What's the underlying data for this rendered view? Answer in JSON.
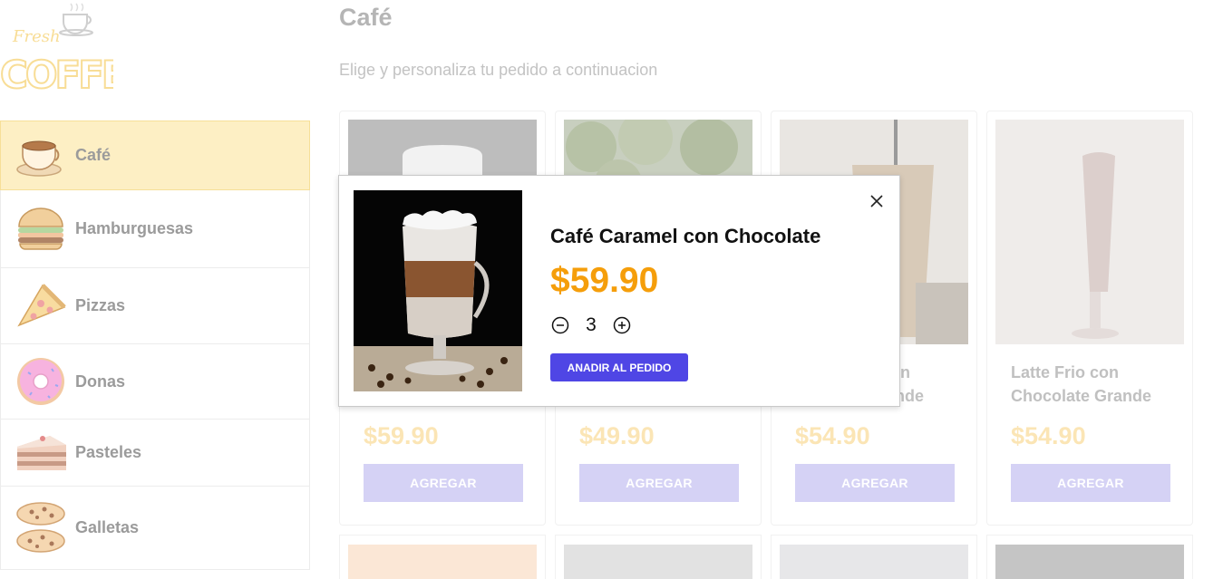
{
  "logo": {
    "line1": "Fresh",
    "line2": "COFFEE"
  },
  "sidebar": {
    "items": [
      {
        "label": "Café",
        "icon": "coffee-cup-icon",
        "active": true
      },
      {
        "label": "Hamburguesas",
        "icon": "burger-icon",
        "active": false
      },
      {
        "label": "Pizzas",
        "icon": "pizza-icon",
        "active": false
      },
      {
        "label": "Donas",
        "icon": "donut-icon",
        "active": false
      },
      {
        "label": "Pasteles",
        "icon": "cake-icon",
        "active": false
      },
      {
        "label": "Galletas",
        "icon": "cookies-icon",
        "active": false
      }
    ]
  },
  "main": {
    "title": "Café",
    "subtitle": "Elige y personaliza tu pedido a continuacion",
    "products": [
      {
        "name_tail": "",
        "price": "$59.90",
        "button": "AGREGAR"
      },
      {
        "name_tail": "",
        "price": "$49.90",
        "button": "AGREGAR"
      },
      {
        "name_tail": "n\nande",
        "price": "$54.90",
        "button": "AGREGAR"
      },
      {
        "name": "Latte Frio con Chocolate Grande",
        "price": "$54.90",
        "button": "AGREGAR"
      }
    ]
  },
  "modal": {
    "name": "Café Caramel con Chocolate",
    "price": "$59.90",
    "quantity": "3",
    "add_label": "ANADIR AL PEDIDO"
  },
  "colors": {
    "accent": "#4f46e5",
    "price": "#f59e0b",
    "active_category": "#fdefc4"
  }
}
